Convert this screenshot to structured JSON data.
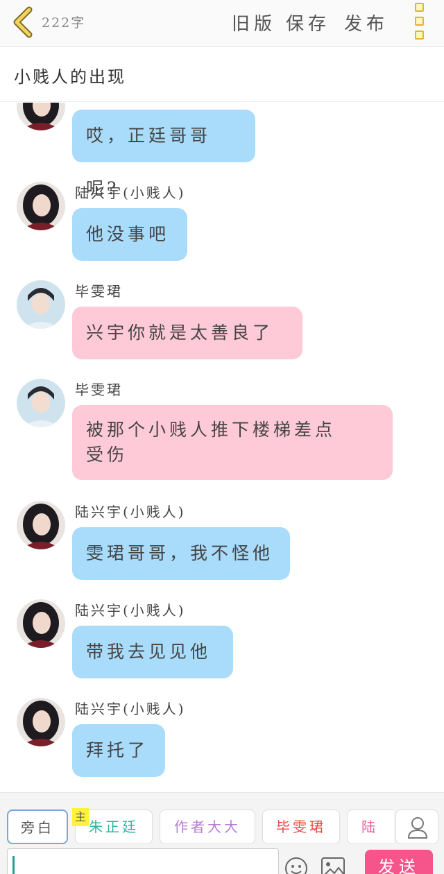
{
  "header": {
    "word_count": "222字",
    "old_version_label": "旧版",
    "save_label": "保存",
    "publish_label": "发布"
  },
  "chapter": {
    "title": "小贱人的出现"
  },
  "messages": [
    {
      "sender": "",
      "text": "哎，正廷哥哥呢?",
      "color": "blue",
      "avatar": "girl"
    },
    {
      "sender": "陆兴宇(小贱人)",
      "text": "他没事吧",
      "color": "blue",
      "avatar": "girl"
    },
    {
      "sender": "毕雯珺",
      "text": "兴宇你就是太善良了",
      "color": "pink",
      "avatar": "boy"
    },
    {
      "sender": "毕雯珺",
      "text_line1": "被那个小贱人推下楼梯差点",
      "text_line2": "受伤",
      "color": "pink",
      "avatar": "boy"
    },
    {
      "sender": "陆兴宇(小贱人)",
      "text": "雯珺哥哥，我不怪他",
      "color": "blue",
      "avatar": "girl"
    },
    {
      "sender": "陆兴宇(小贱人)",
      "text": "带我去见见他",
      "color": "blue",
      "avatar": "girl"
    },
    {
      "sender": "陆兴宇(小贱人)",
      "text": "拜托了",
      "color": "blue",
      "avatar": "girl"
    }
  ],
  "roles": [
    {
      "label": "旁白",
      "color": "#555555",
      "active": true
    },
    {
      "label": "朱正廷",
      "color": "#2bb5a0",
      "badge": "主"
    },
    {
      "label": "作者大大",
      "color": "#b57ad6"
    },
    {
      "label": "毕雯珺",
      "color": "#e8483f"
    },
    {
      "label": "陆兴",
      "color": "#e85c9a"
    }
  ],
  "composer": {
    "input_value": "",
    "send_label": "发送"
  },
  "colors": {
    "blue_bubble": "#a9dcfb",
    "pink_bubble": "#ffcad8",
    "send_button": "#f5558a",
    "main_badge": "#fff23a"
  }
}
